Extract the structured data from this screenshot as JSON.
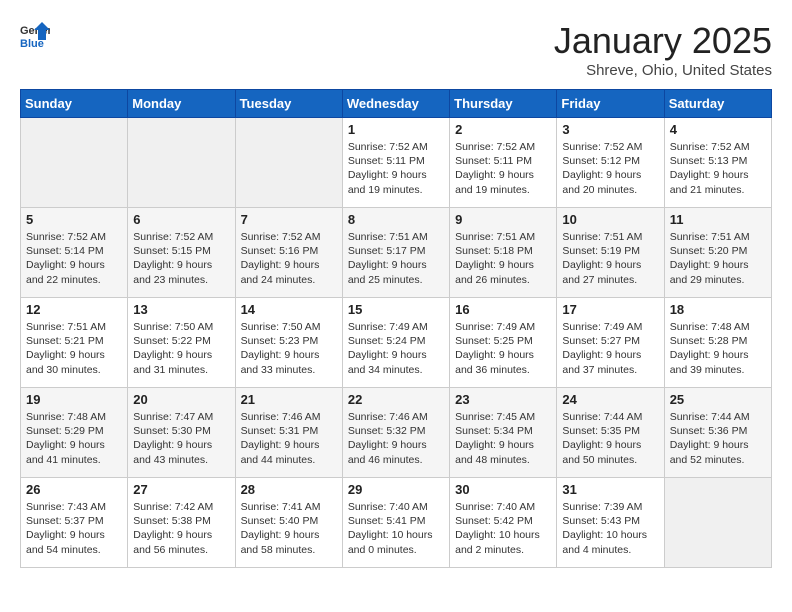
{
  "header": {
    "logo_general": "General",
    "logo_blue": "Blue",
    "month_title": "January 2025",
    "location": "Shreve, Ohio, United States"
  },
  "days_of_week": [
    "Sunday",
    "Monday",
    "Tuesday",
    "Wednesday",
    "Thursday",
    "Friday",
    "Saturday"
  ],
  "weeks": [
    [
      {
        "day": "",
        "info": ""
      },
      {
        "day": "",
        "info": ""
      },
      {
        "day": "",
        "info": ""
      },
      {
        "day": "1",
        "info": "Sunrise: 7:52 AM\nSunset: 5:11 PM\nDaylight: 9 hours\nand 19 minutes."
      },
      {
        "day": "2",
        "info": "Sunrise: 7:52 AM\nSunset: 5:11 PM\nDaylight: 9 hours\nand 19 minutes."
      },
      {
        "day": "3",
        "info": "Sunrise: 7:52 AM\nSunset: 5:12 PM\nDaylight: 9 hours\nand 20 minutes."
      },
      {
        "day": "4",
        "info": "Sunrise: 7:52 AM\nSunset: 5:13 PM\nDaylight: 9 hours\nand 21 minutes."
      }
    ],
    [
      {
        "day": "5",
        "info": "Sunrise: 7:52 AM\nSunset: 5:14 PM\nDaylight: 9 hours\nand 22 minutes."
      },
      {
        "day": "6",
        "info": "Sunrise: 7:52 AM\nSunset: 5:15 PM\nDaylight: 9 hours\nand 23 minutes."
      },
      {
        "day": "7",
        "info": "Sunrise: 7:52 AM\nSunset: 5:16 PM\nDaylight: 9 hours\nand 24 minutes."
      },
      {
        "day": "8",
        "info": "Sunrise: 7:51 AM\nSunset: 5:17 PM\nDaylight: 9 hours\nand 25 minutes."
      },
      {
        "day": "9",
        "info": "Sunrise: 7:51 AM\nSunset: 5:18 PM\nDaylight: 9 hours\nand 26 minutes."
      },
      {
        "day": "10",
        "info": "Sunrise: 7:51 AM\nSunset: 5:19 PM\nDaylight: 9 hours\nand 27 minutes."
      },
      {
        "day": "11",
        "info": "Sunrise: 7:51 AM\nSunset: 5:20 PM\nDaylight: 9 hours\nand 29 minutes."
      }
    ],
    [
      {
        "day": "12",
        "info": "Sunrise: 7:51 AM\nSunset: 5:21 PM\nDaylight: 9 hours\nand 30 minutes."
      },
      {
        "day": "13",
        "info": "Sunrise: 7:50 AM\nSunset: 5:22 PM\nDaylight: 9 hours\nand 31 minutes."
      },
      {
        "day": "14",
        "info": "Sunrise: 7:50 AM\nSunset: 5:23 PM\nDaylight: 9 hours\nand 33 minutes."
      },
      {
        "day": "15",
        "info": "Sunrise: 7:49 AM\nSunset: 5:24 PM\nDaylight: 9 hours\nand 34 minutes."
      },
      {
        "day": "16",
        "info": "Sunrise: 7:49 AM\nSunset: 5:25 PM\nDaylight: 9 hours\nand 36 minutes."
      },
      {
        "day": "17",
        "info": "Sunrise: 7:49 AM\nSunset: 5:27 PM\nDaylight: 9 hours\nand 37 minutes."
      },
      {
        "day": "18",
        "info": "Sunrise: 7:48 AM\nSunset: 5:28 PM\nDaylight: 9 hours\nand 39 minutes."
      }
    ],
    [
      {
        "day": "19",
        "info": "Sunrise: 7:48 AM\nSunset: 5:29 PM\nDaylight: 9 hours\nand 41 minutes."
      },
      {
        "day": "20",
        "info": "Sunrise: 7:47 AM\nSunset: 5:30 PM\nDaylight: 9 hours\nand 43 minutes."
      },
      {
        "day": "21",
        "info": "Sunrise: 7:46 AM\nSunset: 5:31 PM\nDaylight: 9 hours\nand 44 minutes."
      },
      {
        "day": "22",
        "info": "Sunrise: 7:46 AM\nSunset: 5:32 PM\nDaylight: 9 hours\nand 46 minutes."
      },
      {
        "day": "23",
        "info": "Sunrise: 7:45 AM\nSunset: 5:34 PM\nDaylight: 9 hours\nand 48 minutes."
      },
      {
        "day": "24",
        "info": "Sunrise: 7:44 AM\nSunset: 5:35 PM\nDaylight: 9 hours\nand 50 minutes."
      },
      {
        "day": "25",
        "info": "Sunrise: 7:44 AM\nSunset: 5:36 PM\nDaylight: 9 hours\nand 52 minutes."
      }
    ],
    [
      {
        "day": "26",
        "info": "Sunrise: 7:43 AM\nSunset: 5:37 PM\nDaylight: 9 hours\nand 54 minutes."
      },
      {
        "day": "27",
        "info": "Sunrise: 7:42 AM\nSunset: 5:38 PM\nDaylight: 9 hours\nand 56 minutes."
      },
      {
        "day": "28",
        "info": "Sunrise: 7:41 AM\nSunset: 5:40 PM\nDaylight: 9 hours\nand 58 minutes."
      },
      {
        "day": "29",
        "info": "Sunrise: 7:40 AM\nSunset: 5:41 PM\nDaylight: 10 hours\nand 0 minutes."
      },
      {
        "day": "30",
        "info": "Sunrise: 7:40 AM\nSunset: 5:42 PM\nDaylight: 10 hours\nand 2 minutes."
      },
      {
        "day": "31",
        "info": "Sunrise: 7:39 AM\nSunset: 5:43 PM\nDaylight: 10 hours\nand 4 minutes."
      },
      {
        "day": "",
        "info": ""
      }
    ]
  ]
}
